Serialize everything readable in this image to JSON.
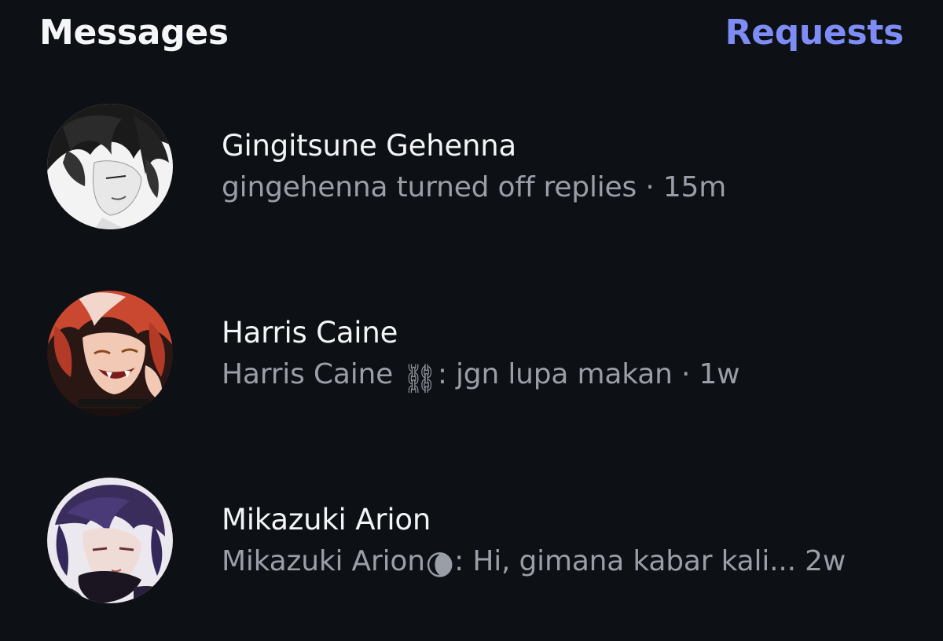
{
  "header": {
    "title": "Messages",
    "requests_label": "Requests"
  },
  "colors": {
    "background": "#0d1015",
    "accent": "#7e8cf5",
    "primary_text": "#f3f4f6",
    "secondary_text": "#9a9ea6"
  },
  "conversations": [
    {
      "name": "Gingitsune Gehenna",
      "preview_prefix": "gingehenna turned off replies",
      "preview_emoji": "",
      "preview_suffix": "",
      "separator": " · ",
      "time": "15m",
      "avatar_icon": "dark-haired-anime-avatar"
    },
    {
      "name": "Harris Caine",
      "preview_prefix": "Harris Caine ",
      "preview_emoji": "⛓",
      "preview_suffix": ": jgn lupa makan",
      "separator": " · ",
      "time": "1w",
      "avatar_icon": "red-haired-anime-avatar"
    },
    {
      "name": "Mikazuki Arion",
      "preview_prefix": "Mikazuki Arion",
      "preview_emoji": "🌘",
      "preview_suffix": ": Hi, gimana kabar kali...",
      "separator": " ",
      "time": "2w",
      "avatar_icon": "purple-haired-anime-avatar"
    }
  ]
}
